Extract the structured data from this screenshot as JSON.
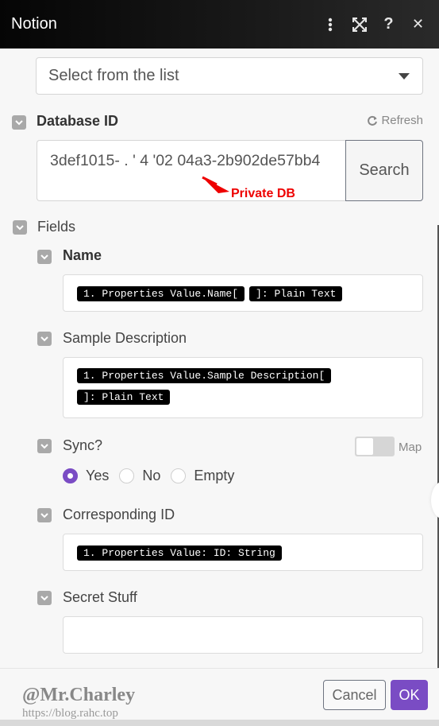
{
  "header": {
    "title": "Notion",
    "icons": [
      "more-vertical-icon",
      "expand-icon",
      "help-icon",
      "close-icon"
    ],
    "help_glyph": "?",
    "close_glyph": "✕"
  },
  "top_select": {
    "value": "Select from the list"
  },
  "database_id": {
    "label": "Database ID",
    "refresh_label": "Refresh",
    "value": "3def1015-  .  ' 4 '02 04a3-2b902de57bb4",
    "search_label": "Search",
    "annotation": "Private DB"
  },
  "fields": {
    "label": "Fields",
    "items": [
      {
        "label": "Name",
        "bold": true,
        "pills": [
          "1. Properties Value.Name[",
          "]: Plain Text"
        ]
      },
      {
        "label": "Sample Description",
        "pills": [
          "1. Properties Value.Sample Description[",
          "]: Plain Text"
        ]
      },
      {
        "label": "Sync?",
        "map_label": "Map",
        "map_enabled": false,
        "options": [
          {
            "label": "Yes",
            "selected": true
          },
          {
            "label": "No",
            "selected": false
          },
          {
            "label": "Empty",
            "selected": false
          }
        ]
      },
      {
        "label": "Corresponding ID",
        "pills": [
          "1. Properties Value: ID: String"
        ]
      },
      {
        "label": "Secret Stuff",
        "value": ""
      }
    ]
  },
  "footer": {
    "cancel_label": "Cancel",
    "ok_label": "OK",
    "watermark": "@Mr.Charley",
    "watermark_url": "https://blog.rahc.top"
  },
  "colors": {
    "accent": "#7a4cc4",
    "header_bg": "#0a0a0a",
    "annotation": "#ee0000"
  }
}
